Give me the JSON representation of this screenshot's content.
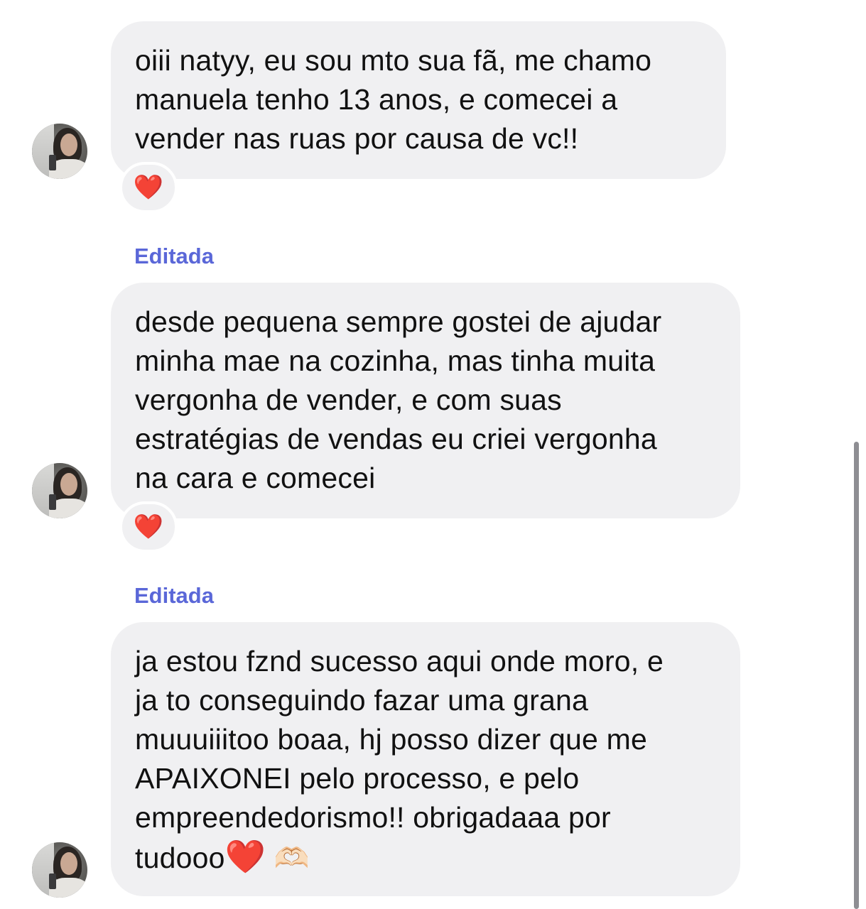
{
  "messages": [
    {
      "lines": [
        "oiii natyy, eu sou mto sua fã, me chamo",
        "manuela tenho 13 anos, e comecei a",
        "vender nas ruas por causa de vc!!"
      ],
      "reaction": "❤️"
    },
    {
      "edited_label": "Editada",
      "lines": [
        "desde pequena sempre gostei de ajudar",
        "minha mae na cozinha, mas tinha muita",
        "vergonha de vender, e com suas",
        "estratégias de vendas eu criei vergonha",
        "na cara e comecei"
      ],
      "reaction": "❤️"
    },
    {
      "edited_label": "Editada",
      "lines": [
        "ja estou fznd sucesso aqui onde moro, e",
        "ja to conseguindo fazar uma grana",
        "muuuiiitoo boaa, hj posso dizer que me",
        "APAIXONEI pelo processo, e pelo",
        "empreendedorismo!! obrigadaaa por",
        "tudooo"
      ],
      "trailing_emojis": [
        "❤️",
        "🫶🏻"
      ]
    }
  ],
  "colors": {
    "bubble": "#f0f0f2",
    "edited_label": "#5a67d8",
    "heart": "#e0202c"
  },
  "icons": [
    "avatar",
    "heart-reaction-icon",
    "heart-hands-icon"
  ]
}
